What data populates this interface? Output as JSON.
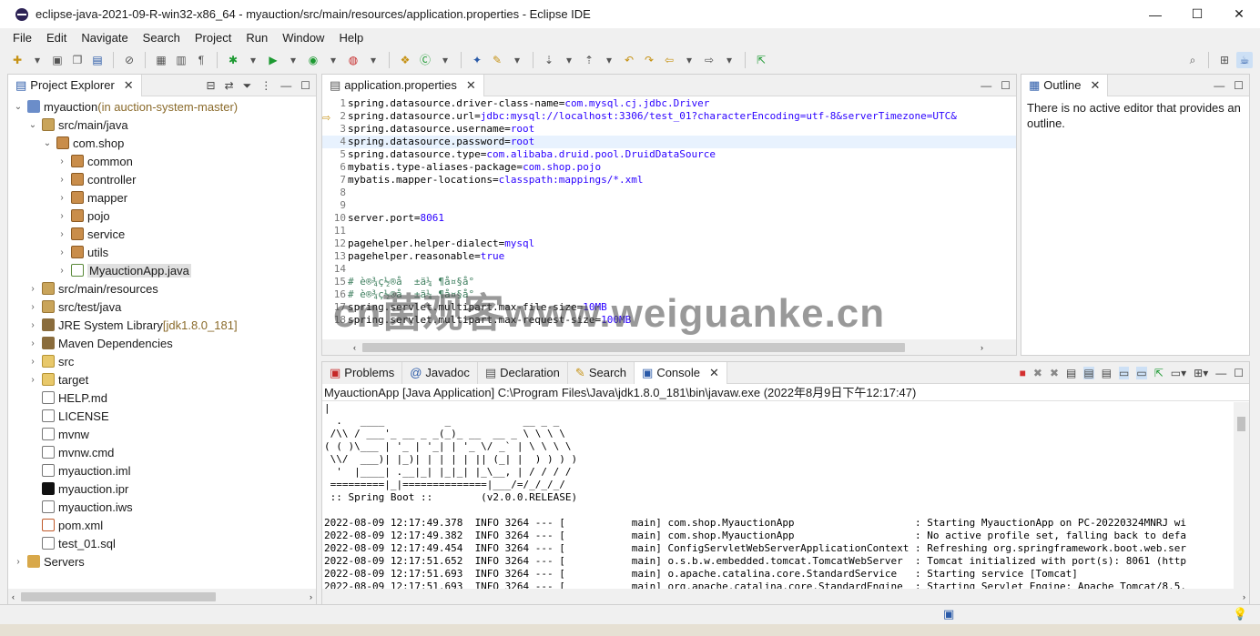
{
  "window": {
    "title": "eclipse-java-2021-09-R-win32-x86_64 - myauction/src/main/resources/application.properties - Eclipse IDE",
    "min": "—",
    "max": "☐",
    "close": "✕"
  },
  "menu": [
    "File",
    "Edit",
    "Navigate",
    "Search",
    "Project",
    "Run",
    "Window",
    "Help"
  ],
  "explorer": {
    "tab": "Project Explorer",
    "rows": [
      {
        "indent": 0,
        "tw": "⌄",
        "icon": "prj",
        "label": "myauction",
        "extra": " (in auction-system-master)",
        "iname": "project-icon"
      },
      {
        "indent": 1,
        "tw": "⌄",
        "icon": "src",
        "label": "src/main/java",
        "iname": "source-folder-icon"
      },
      {
        "indent": 2,
        "tw": "⌄",
        "icon": "pkg",
        "label": "com.shop",
        "iname": "package-icon"
      },
      {
        "indent": 3,
        "tw": "›",
        "icon": "pkg",
        "label": "common",
        "iname": "package-icon"
      },
      {
        "indent": 3,
        "tw": "›",
        "icon": "pkg",
        "label": "controller",
        "iname": "package-icon"
      },
      {
        "indent": 3,
        "tw": "›",
        "icon": "pkg",
        "label": "mapper",
        "iname": "package-icon"
      },
      {
        "indent": 3,
        "tw": "›",
        "icon": "pkg",
        "label": "pojo",
        "iname": "package-icon"
      },
      {
        "indent": 3,
        "tw": "›",
        "icon": "pkg",
        "label": "service",
        "iname": "package-icon"
      },
      {
        "indent": 3,
        "tw": "›",
        "icon": "pkg",
        "label": "utils",
        "iname": "package-icon"
      },
      {
        "indent": 3,
        "tw": "›",
        "icon": "java",
        "label": "MyauctionApp.java",
        "iname": "java-file-icon",
        "sel": true
      },
      {
        "indent": 1,
        "tw": "›",
        "icon": "src",
        "label": "src/main/resources",
        "iname": "source-folder-icon"
      },
      {
        "indent": 1,
        "tw": "›",
        "icon": "src",
        "label": "src/test/java",
        "iname": "source-folder-icon"
      },
      {
        "indent": 1,
        "tw": "›",
        "icon": "jar",
        "label": "JRE System Library",
        "extra": " [jdk1.8.0_181]",
        "iname": "library-icon"
      },
      {
        "indent": 1,
        "tw": "›",
        "icon": "jar",
        "label": "Maven Dependencies",
        "iname": "library-icon"
      },
      {
        "indent": 1,
        "tw": "›",
        "icon": "fld",
        "label": "src",
        "iname": "folder-icon"
      },
      {
        "indent": 1,
        "tw": "›",
        "icon": "fld",
        "label": "target",
        "iname": "folder-icon"
      },
      {
        "indent": 1,
        "tw": "",
        "icon": "file",
        "label": "HELP.md",
        "iname": "markdown-file-icon"
      },
      {
        "indent": 1,
        "tw": "",
        "icon": "file",
        "label": "LICENSE",
        "iname": "file-icon"
      },
      {
        "indent": 1,
        "tw": "",
        "icon": "file",
        "label": "mvnw",
        "iname": "file-icon"
      },
      {
        "indent": 1,
        "tw": "",
        "icon": "file",
        "label": "mvnw.cmd",
        "iname": "file-icon"
      },
      {
        "indent": 1,
        "tw": "",
        "icon": "file",
        "label": "myauction.iml",
        "iname": "file-icon"
      },
      {
        "indent": 1,
        "tw": "",
        "icon": "ij",
        "label": "myauction.ipr",
        "iname": "intellij-file-icon"
      },
      {
        "indent": 1,
        "tw": "",
        "icon": "file",
        "label": "myauction.iws",
        "iname": "file-icon"
      },
      {
        "indent": 1,
        "tw": "",
        "icon": "xml",
        "label": "pom.xml",
        "iname": "xml-file-icon"
      },
      {
        "indent": 1,
        "tw": "",
        "icon": "file",
        "label": "test_01.sql",
        "iname": "sql-file-icon"
      },
      {
        "indent": 0,
        "tw": "›",
        "icon": "srv",
        "label": "Servers",
        "iname": "servers-folder-icon"
      }
    ]
  },
  "editor": {
    "tab": "application.properties",
    "lines": [
      {
        "k": "spring.datasource.driver-class-name=",
        "v": "com.mysql.cj.jdbc.Driver"
      },
      {
        "k": "spring.datasource.url=",
        "v": "jdbc:mysql://localhost:3306/test_01?characterEncoding=utf-8&serverTimezone=UTC&"
      },
      {
        "k": "spring.datasource.username=",
        "v": "root"
      },
      {
        "k": "spring.datasource.password=",
        "v": "root",
        "cur": true
      },
      {
        "k": "spring.datasource.type=",
        "v": "com.alibaba.druid.pool.DruidDataSource"
      },
      {
        "k": "mybatis.type-aliases-package=",
        "v": "com.shop.pojo"
      },
      {
        "k": "mybatis.mapper-locations=",
        "v": "classpath:mappings/*.xml"
      },
      {
        "k": "",
        "v": ""
      },
      {
        "k": "",
        "v": ""
      },
      {
        "k": "server.port=",
        "v": "8061"
      },
      {
        "k": "",
        "v": ""
      },
      {
        "k": "pagehelper.helper-dialect=",
        "v": "mysql"
      },
      {
        "k": "pagehelper.reasonable=",
        "v": "true"
      },
      {
        "k": "",
        "v": ""
      },
      {
        "c": "# è®¾ç½®å  ±ä¼ ¶å¤§å°"
      },
      {
        "c": "# è®¾ç½®å  ±ä¼ ¶å¤§å°"
      },
      {
        "k": "spring.servlet.multipart.max-file-size=",
        "v": "10MB"
      },
      {
        "k": "spring.servlet.multipart.max-request-size=",
        "v": "100MB"
      }
    ]
  },
  "outline": {
    "tab": "Outline",
    "message": "There is no active editor that provides an outline."
  },
  "bottom": {
    "tabs": [
      "Problems",
      "Javadoc",
      "Declaration",
      "Search",
      "Console"
    ],
    "header": "MyauctionApp [Java Application] C:\\Program Files\\Java\\jdk1.8.0_181\\bin\\javaw.exe  (2022年8月9日下午12:17:47)",
    "console": "|\n  .   ____          _            __ _ _\n /\\\\ / ___'_ __ _ _(_)_ __  __ _ \\ \\ \\ \\\n( ( )\\___ | '_ | '_| | '_ \\/ _` | \\ \\ \\ \\\n \\\\/  ___)| |_)| | | | | || (_| |  ) ) ) )\n  '  |____| .__|_| |_|_| |_\\__, | / / / /\n =========|_|==============|___/=/_/_/_/\n :: Spring Boot ::        (v2.0.0.RELEASE)\n\n2022-08-09 12:17:49.378  INFO 3264 --- [           main] com.shop.MyauctionApp                    : Starting MyauctionApp on PC-20220324MNRJ wi\n2022-08-09 12:17:49.382  INFO 3264 --- [           main] com.shop.MyauctionApp                    : No active profile set, falling back to defa\n2022-08-09 12:17:49.454  INFO 3264 --- [           main] ConfigServletWebServerApplicationContext : Refreshing org.springframework.boot.web.ser\n2022-08-09 12:17:51.652  INFO 3264 --- [           main] o.s.b.w.embedded.tomcat.TomcatWebServer  : Tomcat initialized with port(s): 8061 (http\n2022-08-09 12:17:51.693  INFO 3264 --- [           main] o.apache.catalina.core.StandardService   : Starting service [Tomcat]\n2022-08-09 12:17:51.693  INFO 3264 --- [           main] org.apache.catalina.core.StandardEngine  : Starting Servlet Engine: Apache Tomcat/8.5."
  },
  "watermark": "cn菌观客www.weiguanke.cn"
}
